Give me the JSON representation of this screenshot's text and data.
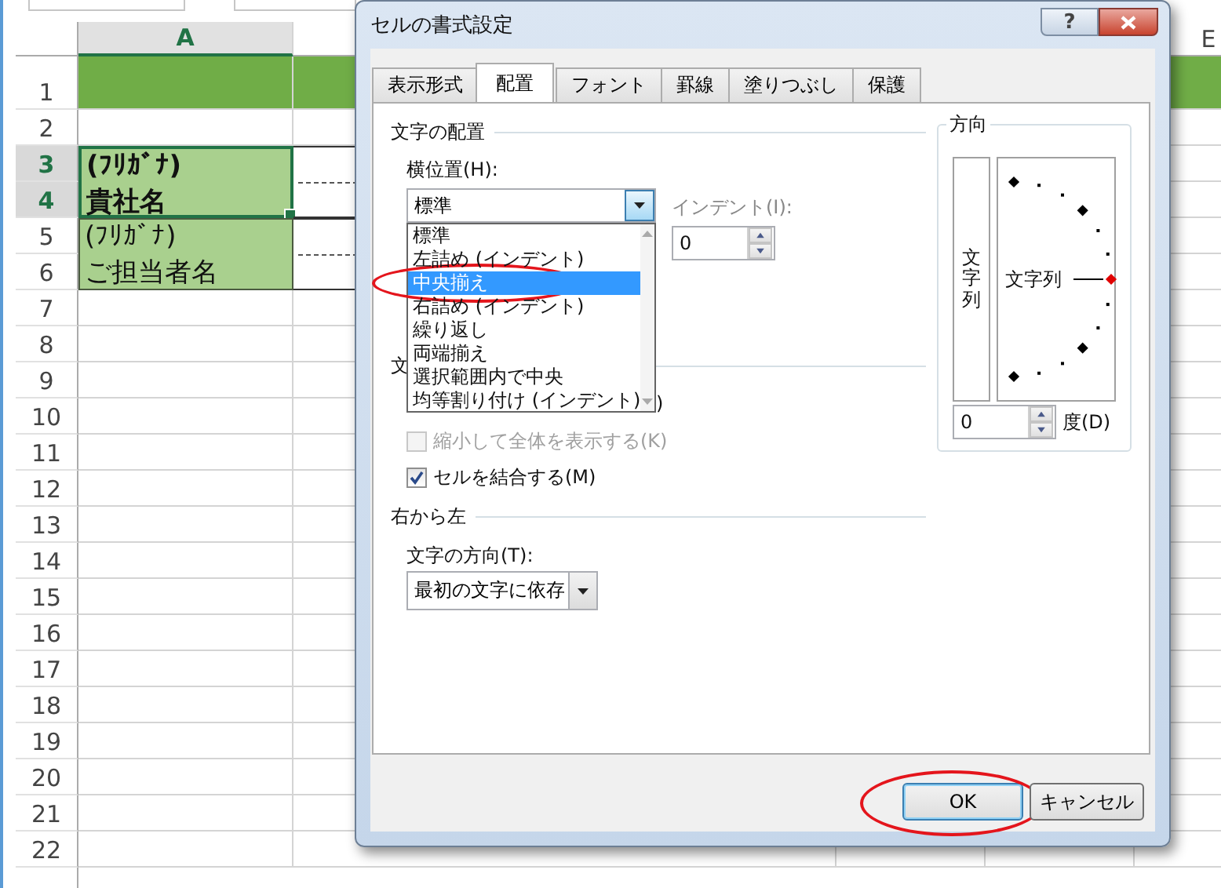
{
  "sheet": {
    "columns": [
      {
        "label": "A",
        "selected": true
      },
      {
        "label": "E",
        "selected": false
      }
    ],
    "rows": [
      {
        "label": "1",
        "selected": false,
        "kind": "band"
      },
      {
        "label": "2",
        "selected": false,
        "kind": "plain"
      },
      {
        "label": "3",
        "selected": true,
        "kind": "plain"
      },
      {
        "label": "4",
        "selected": true,
        "kind": "plain"
      },
      {
        "label": "5",
        "selected": false,
        "kind": "plain"
      },
      {
        "label": "6",
        "selected": false,
        "kind": "plain"
      },
      {
        "label": "7",
        "selected": false,
        "kind": "plain"
      },
      {
        "label": "8",
        "selected": false,
        "kind": "plain"
      },
      {
        "label": "9",
        "selected": false,
        "kind": "plain"
      },
      {
        "label": "10",
        "selected": false,
        "kind": "plain"
      },
      {
        "label": "11",
        "selected": false,
        "kind": "plain"
      },
      {
        "label": "12",
        "selected": false,
        "kind": "plain"
      },
      {
        "label": "13",
        "selected": false,
        "kind": "plain"
      },
      {
        "label": "14",
        "selected": false,
        "kind": "plain"
      },
      {
        "label": "15",
        "selected": false,
        "kind": "plain"
      },
      {
        "label": "16",
        "selected": false,
        "kind": "plain"
      },
      {
        "label": "17",
        "selected": false,
        "kind": "plain"
      },
      {
        "label": "18",
        "selected": false,
        "kind": "plain"
      },
      {
        "label": "19",
        "selected": false,
        "kind": "plain"
      },
      {
        "label": "20",
        "selected": false,
        "kind": "plain"
      },
      {
        "label": "21",
        "selected": false,
        "kind": "plain"
      },
      {
        "label": "22",
        "selected": false,
        "kind": "plain"
      }
    ],
    "blocks": [
      {
        "lines": [
          "(ﾌﾘｶﾞﾅ)",
          "貴社名"
        ],
        "bold": true,
        "selected": true
      },
      {
        "lines": [
          "(ﾌﾘｶﾞﾅ)",
          "ご担当者名"
        ],
        "bold": false,
        "selected": false
      }
    ]
  },
  "dialog": {
    "title": "セルの書式設定",
    "help_button": "?",
    "tabs": [
      {
        "label": "表示形式",
        "selected": false
      },
      {
        "label": "配置",
        "selected": true
      },
      {
        "label": "フォント",
        "selected": false
      },
      {
        "label": "罫線",
        "selected": false
      },
      {
        "label": "塗りつぶし",
        "selected": false
      },
      {
        "label": "保護",
        "selected": false
      }
    ],
    "alignment": {
      "heading": "文字の配置",
      "horizontal_label": "横位置(H):",
      "horizontal_value": "標準",
      "horizontal_options": [
        {
          "label": "標準",
          "selected": false,
          "circled": false
        },
        {
          "label": "左詰め (インデント)",
          "selected": false,
          "circled": false
        },
        {
          "label": "中央揃え",
          "selected": true,
          "circled": true
        },
        {
          "label": "右詰め (インデント)",
          "selected": false,
          "circled": false
        },
        {
          "label": "繰り返し",
          "selected": false,
          "circled": false
        },
        {
          "label": "両端揃え",
          "selected": false,
          "circled": false
        },
        {
          "label": "選択範囲内で中央",
          "selected": false,
          "circled": false
        },
        {
          "label": "均等割り付け (インデント)",
          "selected": false,
          "circled": false
        }
      ],
      "indent_label": "インデント(I):",
      "indent_value": "0"
    },
    "control": {
      "heading": "文",
      "hidden_fragment": ")",
      "options": [
        {
          "label": "縮小して全体を表示する(K)",
          "checked": false,
          "disabled": true
        },
        {
          "label": "セルを結合する(M)",
          "checked": true,
          "disabled": false
        }
      ]
    },
    "rtl": {
      "heading": "右から左",
      "direction_label": "文字の方向(T):",
      "direction_value": "最初の文字に依存"
    },
    "orientation": {
      "heading": "方向",
      "vertical_text": "文字列",
      "dial_text": "文字列",
      "degrees_value": "0",
      "degrees_label": "度(D)"
    },
    "buttons": [
      {
        "label": "OK",
        "kind": "default",
        "circled": true
      },
      {
        "label": "キャンセル",
        "kind": "normal",
        "circled": false
      }
    ]
  }
}
